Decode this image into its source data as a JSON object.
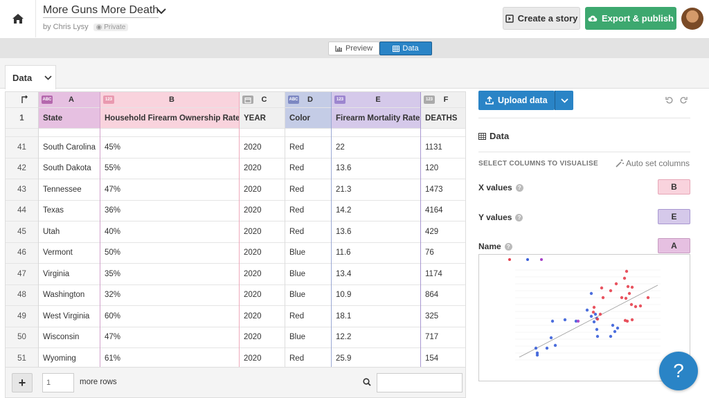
{
  "header": {
    "title": "More Guns More Death",
    "author": "by Chris Lysy",
    "privacy": "Private",
    "create_story": "Create a story",
    "export_publish": "Export & publish"
  },
  "view_toggle": {
    "preview": "Preview",
    "data": "Data"
  },
  "sheet_tab": "Data",
  "columns": [
    {
      "letter": "A",
      "type": "ABC",
      "name": "State"
    },
    {
      "letter": "B",
      "type": "123",
      "name": "Household Firearm Ownership Rate"
    },
    {
      "letter": "C",
      "type": "date",
      "name": "YEAR"
    },
    {
      "letter": "D",
      "type": "ABC",
      "name": "Color"
    },
    {
      "letter": "E",
      "type": "123",
      "name": "Firearm Mortality Rate"
    },
    {
      "letter": "F",
      "type": "123",
      "name": "DEATHS"
    }
  ],
  "header_row_num": "1",
  "rows": [
    {
      "num": "41",
      "state": "South Carolina",
      "ownership": "45%",
      "year": "2020",
      "color": "Red",
      "mortality": "22",
      "deaths": "1131"
    },
    {
      "num": "42",
      "state": "South Dakota",
      "ownership": "55%",
      "year": "2020",
      "color": "Red",
      "mortality": "13.6",
      "deaths": "120"
    },
    {
      "num": "43",
      "state": "Tennessee",
      "ownership": "47%",
      "year": "2020",
      "color": "Red",
      "mortality": "21.3",
      "deaths": "1473"
    },
    {
      "num": "44",
      "state": "Texas",
      "ownership": "36%",
      "year": "2020",
      "color": "Red",
      "mortality": "14.2",
      "deaths": "4164"
    },
    {
      "num": "45",
      "state": "Utah",
      "ownership": "40%",
      "year": "2020",
      "color": "Red",
      "mortality": "13.6",
      "deaths": "429"
    },
    {
      "num": "46",
      "state": "Vermont",
      "ownership": "50%",
      "year": "2020",
      "color": "Blue",
      "mortality": "11.6",
      "deaths": "76"
    },
    {
      "num": "47",
      "state": "Virginia",
      "ownership": "35%",
      "year": "2020",
      "color": "Blue",
      "mortality": "13.4",
      "deaths": "1174"
    },
    {
      "num": "48",
      "state": "Washington",
      "ownership": "32%",
      "year": "2020",
      "color": "Blue",
      "mortality": "10.9",
      "deaths": "864"
    },
    {
      "num": "49",
      "state": "West Virginia",
      "ownership": "60%",
      "year": "2020",
      "color": "Red",
      "mortality": "18.1",
      "deaths": "325"
    },
    {
      "num": "50",
      "state": "Wisconsin",
      "ownership": "47%",
      "year": "2020",
      "color": "Blue",
      "mortality": "12.2",
      "deaths": "717"
    },
    {
      "num": "51",
      "state": "Wyoming",
      "ownership": "61%",
      "year": "2020",
      "color": "Red",
      "mortality": "25.9",
      "deaths": "154"
    }
  ],
  "bottom": {
    "add": "+",
    "rows_value": "1",
    "more_rows": "more rows"
  },
  "panel": {
    "upload": "Upload data",
    "data_heading": "Data",
    "select_label": "SELECT COLUMNS TO VISUALISE",
    "auto_set": "Auto set columns",
    "bindings": [
      {
        "label": "X values",
        "column": "B"
      },
      {
        "label": "Y values",
        "column": "E"
      },
      {
        "label": "Name",
        "column": "A"
      }
    ]
  },
  "help_fab": "?",
  "colors": {
    "red_dot": "#e5414f",
    "blue_dot": "#3a5fd9",
    "purple_dot": "#a63fc7",
    "accent_blue": "#2a84c6",
    "green": "#3da86f"
  }
}
